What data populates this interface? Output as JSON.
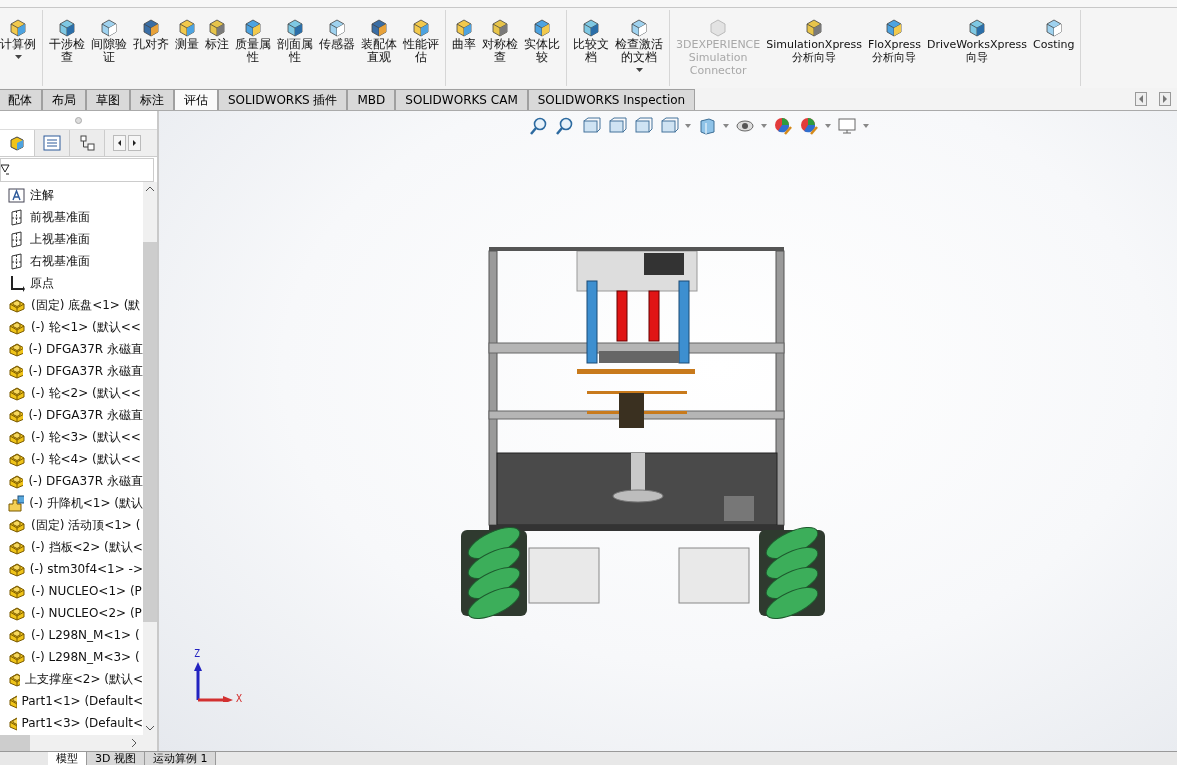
{
  "ribbon": {
    "groups": [
      {
        "buttons": [
          {
            "label": "计算例",
            "disabled": false,
            "dropdown": true
          }
        ]
      },
      {
        "buttons": [
          {
            "label": "干涉检查",
            "disabled": false,
            "dropdown": false
          },
          {
            "label": "间隙验证",
            "disabled": false,
            "dropdown": false
          },
          {
            "label": "孔对齐",
            "disabled": false,
            "dropdown": false
          },
          {
            "label": "测量",
            "disabled": false,
            "dropdown": false
          },
          {
            "label": "标注",
            "disabled": false,
            "dropdown": false
          },
          {
            "label": "质量属性",
            "disabled": false,
            "dropdown": false
          },
          {
            "label": "剖面属性",
            "disabled": false,
            "dropdown": false
          },
          {
            "label": "传感器",
            "disabled": false,
            "dropdown": false
          },
          {
            "label": "装配体直观",
            "disabled": false,
            "dropdown": false
          },
          {
            "label": "性能评估",
            "disabled": false,
            "dropdown": false
          }
        ]
      },
      {
        "buttons": [
          {
            "label": "曲率",
            "disabled": false,
            "dropdown": false
          },
          {
            "label": "对称检查",
            "disabled": false,
            "dropdown": false
          },
          {
            "label": "实体比较",
            "disabled": false,
            "dropdown": false
          }
        ]
      },
      {
        "buttons": [
          {
            "label": "比较文档",
            "disabled": false,
            "dropdown": false
          },
          {
            "label": "检查激活的文档",
            "disabled": false,
            "dropdown": true
          }
        ]
      },
      {
        "buttons": [
          {
            "label": "3DEXPERIENCE\nSimulation\nConnector",
            "disabled": true,
            "dropdown": false
          },
          {
            "label": "SimulationXpress\n分析向导",
            "disabled": false,
            "dropdown": false
          },
          {
            "label": "FloXpress\n分析向导",
            "disabled": false,
            "dropdown": false
          },
          {
            "label": "DriveWorksXpress\n向导",
            "disabled": false,
            "dropdown": false
          },
          {
            "label": "Costing",
            "disabled": false,
            "dropdown": false
          }
        ]
      }
    ]
  },
  "tabs": [
    {
      "label": "配体",
      "selected": false
    },
    {
      "label": "布局",
      "selected": false
    },
    {
      "label": "草图",
      "selected": false
    },
    {
      "label": "标注",
      "selected": false
    },
    {
      "label": "评估",
      "selected": true
    },
    {
      "label": "SOLIDWORKS 插件",
      "selected": false
    },
    {
      "label": "MBD",
      "selected": false
    },
    {
      "label": "SOLIDWORKS CAM",
      "selected": false
    },
    {
      "label": "SOLIDWORKS Inspection",
      "selected": false
    }
  ],
  "tree": [
    {
      "kind": "annotation",
      "label": "注解"
    },
    {
      "kind": "plane",
      "label": "前视基准面"
    },
    {
      "kind": "plane",
      "label": "上视基准面"
    },
    {
      "kind": "plane",
      "label": "右视基准面"
    },
    {
      "kind": "origin",
      "label": "原点"
    },
    {
      "kind": "part",
      "label": "(固定) 底盘<1> (默"
    },
    {
      "kind": "part",
      "label": "(-) 轮<1> (默认<<"
    },
    {
      "kind": "part",
      "label": "(-) DFGA37R 永磁直"
    },
    {
      "kind": "part",
      "label": "(-) DFGA37R 永磁直"
    },
    {
      "kind": "part",
      "label": "(-) 轮<2> (默认<<"
    },
    {
      "kind": "part",
      "label": "(-) DFGA37R 永磁直"
    },
    {
      "kind": "part",
      "label": "(-) 轮<3> (默认<<"
    },
    {
      "kind": "part",
      "label": "(-) 轮<4> (默认<<"
    },
    {
      "kind": "part",
      "label": "(-) DFGA37R 永磁直"
    },
    {
      "kind": "assembly",
      "label": "(-) 升降机<1> (默认"
    },
    {
      "kind": "part",
      "label": "(固定) 活动顶<1> ("
    },
    {
      "kind": "part",
      "label": "(-) 挡板<2> (默认<"
    },
    {
      "kind": "part",
      "label": "(-) stm30f4<1> ->"
    },
    {
      "kind": "part",
      "label": "(-) NUCLEO<1> (P"
    },
    {
      "kind": "part",
      "label": "(-) NUCLEO<2> (P"
    },
    {
      "kind": "part",
      "label": "(-) L298N_M<1> ("
    },
    {
      "kind": "part",
      "label": "(-) L298N_M<3> ("
    },
    {
      "kind": "part",
      "label": "上支撑座<2> (默认<"
    },
    {
      "kind": "part",
      "label": "Part1<1> (Default<"
    },
    {
      "kind": "part",
      "label": "Part1<3> (Default<"
    }
  ],
  "triad": {
    "z": "Z",
    "x": "X"
  },
  "bottom_tabs": [
    {
      "label": "模型",
      "selected": true
    },
    {
      "label": "3D 视图",
      "selected": false
    },
    {
      "label": "运动算例 1",
      "selected": false
    }
  ]
}
